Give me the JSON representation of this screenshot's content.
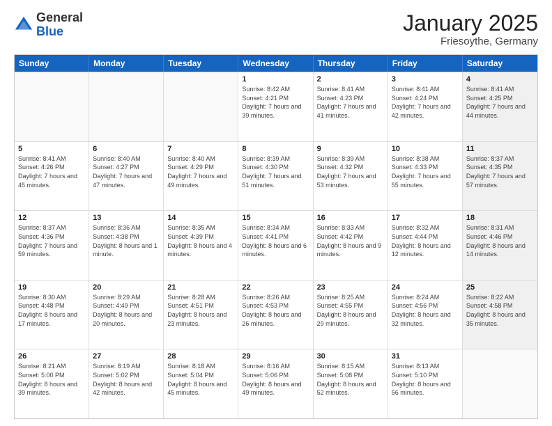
{
  "header": {
    "logo": {
      "general": "General",
      "blue": "Blue"
    },
    "title": "January 2025",
    "subtitle": "Friesoythe, Germany"
  },
  "days_of_week": [
    "Sunday",
    "Monday",
    "Tuesday",
    "Wednesday",
    "Thursday",
    "Friday",
    "Saturday"
  ],
  "weeks": [
    [
      {
        "day": "",
        "empty": true
      },
      {
        "day": "",
        "empty": true
      },
      {
        "day": "",
        "empty": true
      },
      {
        "day": "1",
        "sunrise": "Sunrise: 8:42 AM",
        "sunset": "Sunset: 4:21 PM",
        "daylight": "Daylight: 7 hours and 39 minutes."
      },
      {
        "day": "2",
        "sunrise": "Sunrise: 8:41 AM",
        "sunset": "Sunset: 4:23 PM",
        "daylight": "Daylight: 7 hours and 41 minutes."
      },
      {
        "day": "3",
        "sunrise": "Sunrise: 8:41 AM",
        "sunset": "Sunset: 4:24 PM",
        "daylight": "Daylight: 7 hours and 42 minutes."
      },
      {
        "day": "4",
        "sunrise": "Sunrise: 8:41 AM",
        "sunset": "Sunset: 4:25 PM",
        "daylight": "Daylight: 7 hours and 44 minutes.",
        "shaded": true
      }
    ],
    [
      {
        "day": "5",
        "sunrise": "Sunrise: 8:41 AM",
        "sunset": "Sunset: 4:26 PM",
        "daylight": "Daylight: 7 hours and 45 minutes."
      },
      {
        "day": "6",
        "sunrise": "Sunrise: 8:40 AM",
        "sunset": "Sunset: 4:27 PM",
        "daylight": "Daylight: 7 hours and 47 minutes."
      },
      {
        "day": "7",
        "sunrise": "Sunrise: 8:40 AM",
        "sunset": "Sunset: 4:29 PM",
        "daylight": "Daylight: 7 hours and 49 minutes."
      },
      {
        "day": "8",
        "sunrise": "Sunrise: 8:39 AM",
        "sunset": "Sunset: 4:30 PM",
        "daylight": "Daylight: 7 hours and 51 minutes."
      },
      {
        "day": "9",
        "sunrise": "Sunrise: 8:39 AM",
        "sunset": "Sunset: 4:32 PM",
        "daylight": "Daylight: 7 hours and 53 minutes."
      },
      {
        "day": "10",
        "sunrise": "Sunrise: 8:38 AM",
        "sunset": "Sunset: 4:33 PM",
        "daylight": "Daylight: 7 hours and 55 minutes."
      },
      {
        "day": "11",
        "sunrise": "Sunrise: 8:37 AM",
        "sunset": "Sunset: 4:35 PM",
        "daylight": "Daylight: 7 hours and 57 minutes.",
        "shaded": true
      }
    ],
    [
      {
        "day": "12",
        "sunrise": "Sunrise: 8:37 AM",
        "sunset": "Sunset: 4:36 PM",
        "daylight": "Daylight: 7 hours and 59 minutes."
      },
      {
        "day": "13",
        "sunrise": "Sunrise: 8:36 AM",
        "sunset": "Sunset: 4:38 PM",
        "daylight": "Daylight: 8 hours and 1 minute."
      },
      {
        "day": "14",
        "sunrise": "Sunrise: 8:35 AM",
        "sunset": "Sunset: 4:39 PM",
        "daylight": "Daylight: 8 hours and 4 minutes."
      },
      {
        "day": "15",
        "sunrise": "Sunrise: 8:34 AM",
        "sunset": "Sunset: 4:41 PM",
        "daylight": "Daylight: 8 hours and 6 minutes."
      },
      {
        "day": "16",
        "sunrise": "Sunrise: 8:33 AM",
        "sunset": "Sunset: 4:42 PM",
        "daylight": "Daylight: 8 hours and 9 minutes."
      },
      {
        "day": "17",
        "sunrise": "Sunrise: 8:32 AM",
        "sunset": "Sunset: 4:44 PM",
        "daylight": "Daylight: 8 hours and 12 minutes."
      },
      {
        "day": "18",
        "sunrise": "Sunrise: 8:31 AM",
        "sunset": "Sunset: 4:46 PM",
        "daylight": "Daylight: 8 hours and 14 minutes.",
        "shaded": true
      }
    ],
    [
      {
        "day": "19",
        "sunrise": "Sunrise: 8:30 AM",
        "sunset": "Sunset: 4:48 PM",
        "daylight": "Daylight: 8 hours and 17 minutes."
      },
      {
        "day": "20",
        "sunrise": "Sunrise: 8:29 AM",
        "sunset": "Sunset: 4:49 PM",
        "daylight": "Daylight: 8 hours and 20 minutes."
      },
      {
        "day": "21",
        "sunrise": "Sunrise: 8:28 AM",
        "sunset": "Sunset: 4:51 PM",
        "daylight": "Daylight: 8 hours and 23 minutes."
      },
      {
        "day": "22",
        "sunrise": "Sunrise: 8:26 AM",
        "sunset": "Sunset: 4:53 PM",
        "daylight": "Daylight: 8 hours and 26 minutes."
      },
      {
        "day": "23",
        "sunrise": "Sunrise: 8:25 AM",
        "sunset": "Sunset: 4:55 PM",
        "daylight": "Daylight: 8 hours and 29 minutes."
      },
      {
        "day": "24",
        "sunrise": "Sunrise: 8:24 AM",
        "sunset": "Sunset: 4:56 PM",
        "daylight": "Daylight: 8 hours and 32 minutes."
      },
      {
        "day": "25",
        "sunrise": "Sunrise: 8:22 AM",
        "sunset": "Sunset: 4:58 PM",
        "daylight": "Daylight: 8 hours and 35 minutes.",
        "shaded": true
      }
    ],
    [
      {
        "day": "26",
        "sunrise": "Sunrise: 8:21 AM",
        "sunset": "Sunset: 5:00 PM",
        "daylight": "Daylight: 8 hours and 39 minutes."
      },
      {
        "day": "27",
        "sunrise": "Sunrise: 8:19 AM",
        "sunset": "Sunset: 5:02 PM",
        "daylight": "Daylight: 8 hours and 42 minutes."
      },
      {
        "day": "28",
        "sunrise": "Sunrise: 8:18 AM",
        "sunset": "Sunset: 5:04 PM",
        "daylight": "Daylight: 8 hours and 45 minutes."
      },
      {
        "day": "29",
        "sunrise": "Sunrise: 8:16 AM",
        "sunset": "Sunset: 5:06 PM",
        "daylight": "Daylight: 8 hours and 49 minutes."
      },
      {
        "day": "30",
        "sunrise": "Sunrise: 8:15 AM",
        "sunset": "Sunset: 5:08 PM",
        "daylight": "Daylight: 8 hours and 52 minutes."
      },
      {
        "day": "31",
        "sunrise": "Sunrise: 8:13 AM",
        "sunset": "Sunset: 5:10 PM",
        "daylight": "Daylight: 8 hours and 56 minutes."
      },
      {
        "day": "",
        "empty": true,
        "shaded": true
      }
    ]
  ]
}
